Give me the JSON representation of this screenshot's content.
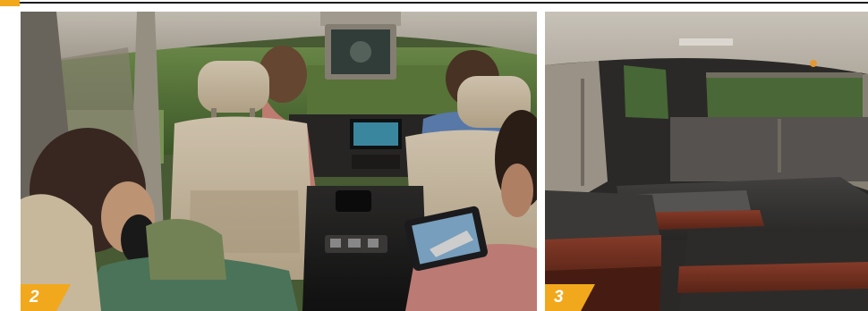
{
  "badges": {
    "photo_2": "2",
    "photo_3": "3"
  },
  "colors": {
    "accent_orange": "#f2a81c",
    "rule": "#1b1b1b"
  }
}
